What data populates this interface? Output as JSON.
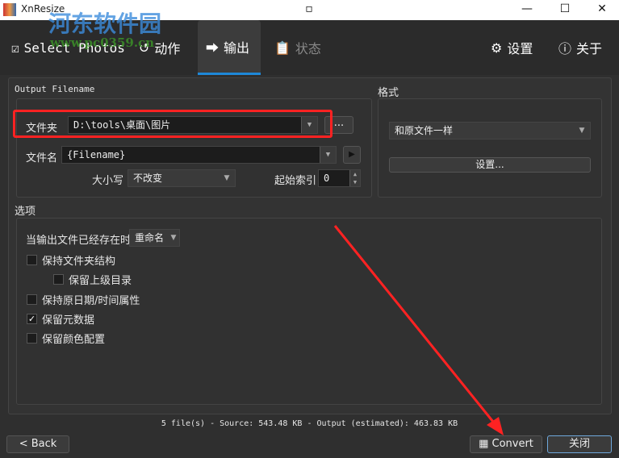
{
  "window": {
    "title": "XnResize",
    "minimize": "—",
    "maximize": "☐",
    "close": "✕"
  },
  "watermark": {
    "name": "河东软件园",
    "url": "www.pc0359.cn"
  },
  "toolbar": {
    "select_photos": "Select Photos",
    "actions": "动作",
    "output": "输出",
    "status": "状态",
    "settings": "设置",
    "about": "关于"
  },
  "output_filename": {
    "title": "Output Filename",
    "folder_label": "文件夹",
    "folder_value": "D:\\tools\\桌面\\图片",
    "browse": "...",
    "filename_label": "文件名",
    "filename_value": "{Filename}",
    "case_label": "大小写",
    "case_value": "不改变",
    "start_index_label": "起始索引",
    "start_index_value": "0"
  },
  "format": {
    "title": "格式",
    "value": "和原文件一样",
    "settings_button": "设置..."
  },
  "options": {
    "title": "选项",
    "exists_label": "当输出文件已经存在时",
    "exists_value": "重命名",
    "checkboxes": [
      {
        "label": "保持文件夹结构",
        "checked": false
      },
      {
        "label": "保留上级目录",
        "checked": false
      },
      {
        "label": "保持原日期/时间属性",
        "checked": false
      },
      {
        "label": "保留元数据",
        "checked": true
      },
      {
        "label": "保留颜色配置",
        "checked": false
      }
    ]
  },
  "status": "5 file(s) - Source: 543.48 KB - Output (estimated): 463.83 KB",
  "footer": {
    "back": "< Back",
    "convert": "Convert",
    "close": "关闭"
  }
}
